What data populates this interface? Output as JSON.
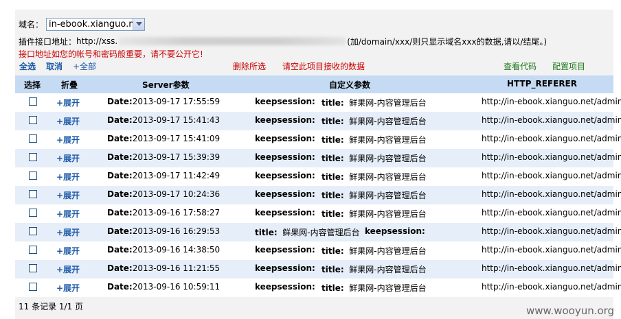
{
  "domain_row": {
    "label": "域名：",
    "selected": "in-ebook.xianguo.net"
  },
  "api_row": {
    "label": "插件接口地址：",
    "url_start": "http://xss.",
    "hint": "(加/domain/xxx/则只显示域名xxx的数据,请以/结尾。)"
  },
  "warning": "接口地址如您的帐号和密码般重要，请不要公开它!",
  "actions": {
    "select_all": "全选",
    "cancel": "取消",
    "expand_all": "+全部",
    "delete_selected": "删除所选",
    "clear_all": "请空此项目接收的数据",
    "view_code": "查看代码",
    "config": "配置项目"
  },
  "table": {
    "headers": {
      "select": "选择",
      "fold": "折叠",
      "server": "Server参数",
      "custom": "自定义参数",
      "referer": "HTTP_REFERER"
    },
    "date_label": "Date:",
    "expand_label": "+展开",
    "keepsession": "keepsession:",
    "title_label": "title:",
    "title_value": "鲜果网-内容管理后台",
    "referer": "http://in-ebook.xianguo.net/admin/",
    "rows": [
      {
        "date": "2013-09-17 17:55:59"
      },
      {
        "date": "2013-09-17 15:41:43"
      },
      {
        "date": "2013-09-17 15:41:09"
      },
      {
        "date": "2013-09-17 15:39:39"
      },
      {
        "date": "2013-09-17 11:42:49"
      },
      {
        "date": "2013-09-17 10:24:36"
      },
      {
        "date": "2013-09-16 17:58:27"
      },
      {
        "date": "2013-09-16 16:29:53"
      },
      {
        "date": "2013-09-16 14:38:50"
      },
      {
        "date": "2013-09-16 11:21:55"
      },
      {
        "date": "2013-09-16 10:59:11"
      }
    ]
  },
  "footer": "11 条记录 1/1 页",
  "watermark": "www.wooyun.org"
}
